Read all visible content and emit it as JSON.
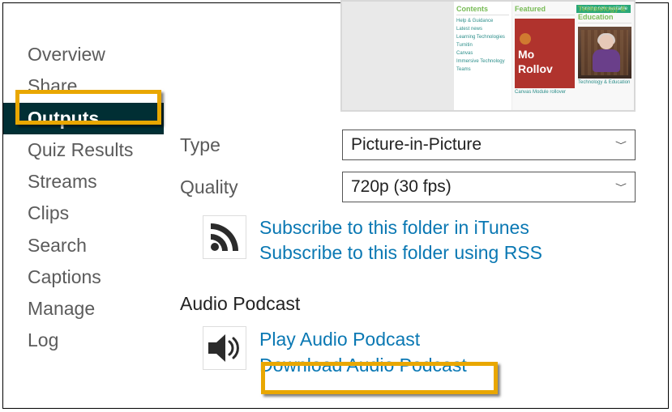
{
  "sidebar": {
    "items": [
      {
        "label": "Overview"
      },
      {
        "label": "Share"
      },
      {
        "label": "Outputs",
        "selected": true
      },
      {
        "label": "Quiz Results"
      },
      {
        "label": "Streams"
      },
      {
        "label": "Clips"
      },
      {
        "label": "Search"
      },
      {
        "label": "Captions"
      },
      {
        "label": "Manage"
      },
      {
        "label": "Log"
      }
    ]
  },
  "preview": {
    "badge": "Training now available",
    "contents_heading": "Contents",
    "contents_items": [
      "Help & Guidance",
      "Latest news",
      "Learning Technologies",
      "Turnitin",
      "Canvas",
      "Immersive Technology",
      "Teams"
    ],
    "featured_heading": "Featured",
    "featured_title1": "Mo",
    "featured_title2": "Rollov",
    "featured_caption": "Canvas Module rollover",
    "right_heading": "Technology & Education",
    "right_caption": "Technology & Education"
  },
  "form": {
    "type_label": "Type",
    "type_value": "Picture-in-Picture",
    "quality_label": "Quality",
    "quality_value": "720p (30 fps)"
  },
  "rss": {
    "itunes": "Subscribe to this folder in iTunes",
    "link": "Subscribe to this folder using RSS"
  },
  "audio": {
    "heading": "Audio Podcast",
    "play": "Play Audio Podcast",
    "download": "Download Audio Podcast"
  }
}
